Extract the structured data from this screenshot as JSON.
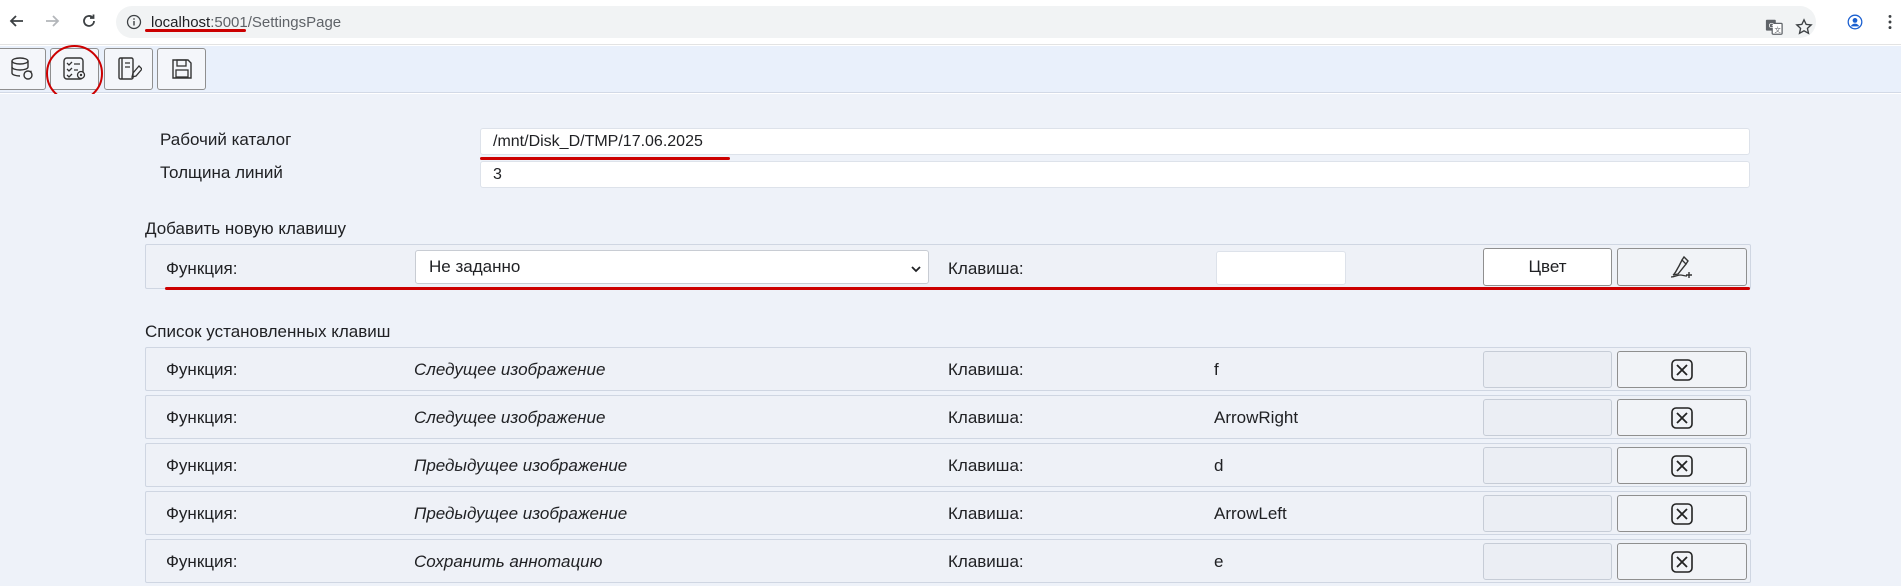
{
  "browser": {
    "url_host": "localhost",
    "url_port": ":5001",
    "url_path": "/SettingsPage",
    "icons": [
      "back-arrow-icon",
      "forward-arrow-icon",
      "reload-icon",
      "info-icon",
      "translate-icon",
      "star-icon",
      "profile-icon",
      "more-vert-icon"
    ]
  },
  "toolbar": {
    "buttons": [
      "database-icon",
      "checklist-settings-icon",
      "notes-edit-icon",
      "save-icon"
    ]
  },
  "settings": {
    "work_dir_label": "Рабочий каталог",
    "work_dir_value": "/mnt/Disk_D/TMP/17.06.2025",
    "line_width_label": "Толщина линий",
    "line_width_value": "3"
  },
  "add_key": {
    "section_title": "Добавить новую клавишу",
    "function_label": "Функция:",
    "function_selected": "Не заданно",
    "key_label": "Клавиша:",
    "key_value": "",
    "color_button": "Цвет"
  },
  "installed": {
    "section_title": "Список установленных клавиш",
    "function_label": "Функция:",
    "key_label": "Клавиша:",
    "rows": [
      {
        "function": "Следущее изображение",
        "key": "f"
      },
      {
        "function": "Следущее изображение",
        "key": "ArrowRight"
      },
      {
        "function": "Предыдущее изображение",
        "key": "d"
      },
      {
        "function": "Предыдущее изображение",
        "key": "ArrowLeft"
      },
      {
        "function": "Сохранить аннотацию",
        "key": "e"
      }
    ]
  },
  "colors": {
    "annotation_red": "#cc0000",
    "toolbar_bg": "#e9f0fb",
    "page_bg": "#eef2f9"
  }
}
